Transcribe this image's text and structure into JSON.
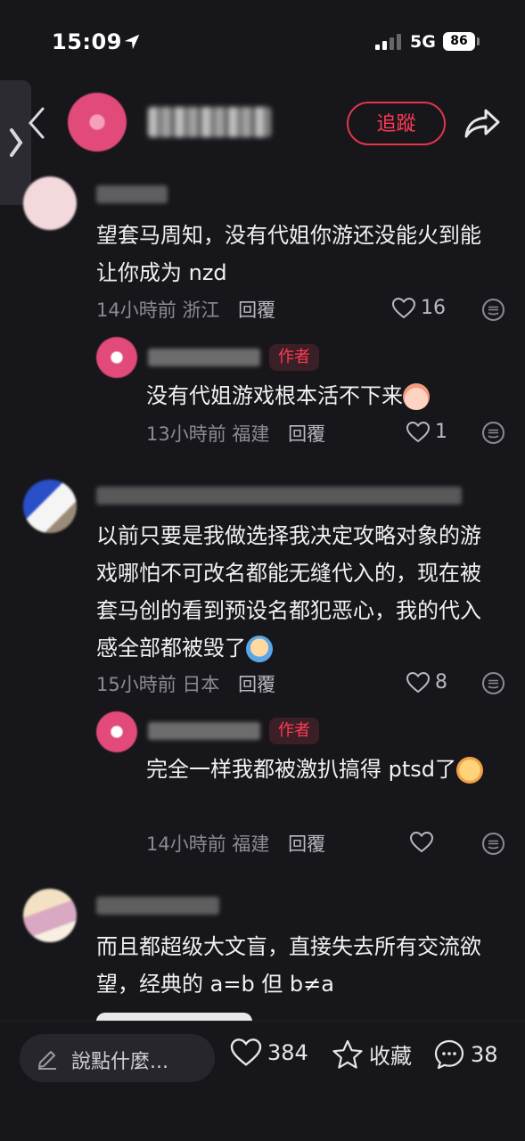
{
  "status_bar": {
    "time": "15:09",
    "network": "5G",
    "battery": "86"
  },
  "header": {
    "follow_label": "追蹤"
  },
  "comments": [
    {
      "text": "望套马周知，没有代姐你游还没能火到能让你成为 nzd",
      "time": "14小時前",
      "location": "浙江",
      "reply_label": "回覆",
      "likes": "16",
      "reply": {
        "author_tag": "作者",
        "text": "没有代姐游戏根本活不下来",
        "time": "13小時前",
        "location": "福建",
        "reply_label": "回覆",
        "likes": "1"
      }
    },
    {
      "text": "以前只要是我做选择我决定攻略对象的游戏哪怕不可改名都能无缝代入的，现在被套马创的看到预设名都犯恶心，我的代入感全部都被毁了",
      "time": "15小時前",
      "location": "日本",
      "reply_label": "回覆",
      "likes": "8",
      "reply": {
        "author_tag": "作者",
        "text": "完全一样我都被激扒搞得 ptsd了",
        "time": "14小時前",
        "location": "福建",
        "reply_label": "回覆",
        "likes": ""
      }
    },
    {
      "text": "而且都超级大文盲，直接失去所有交流欲望，经典的 a=b 但 b≠a"
    }
  ],
  "bottom_bar": {
    "input_placeholder": "說點什麼...",
    "likes": "384",
    "favorite_label": "收藏",
    "comments": "38"
  },
  "colors": {
    "accent": "#ff3b55",
    "background": "#17171b",
    "muted_text": "#8a8a93"
  }
}
